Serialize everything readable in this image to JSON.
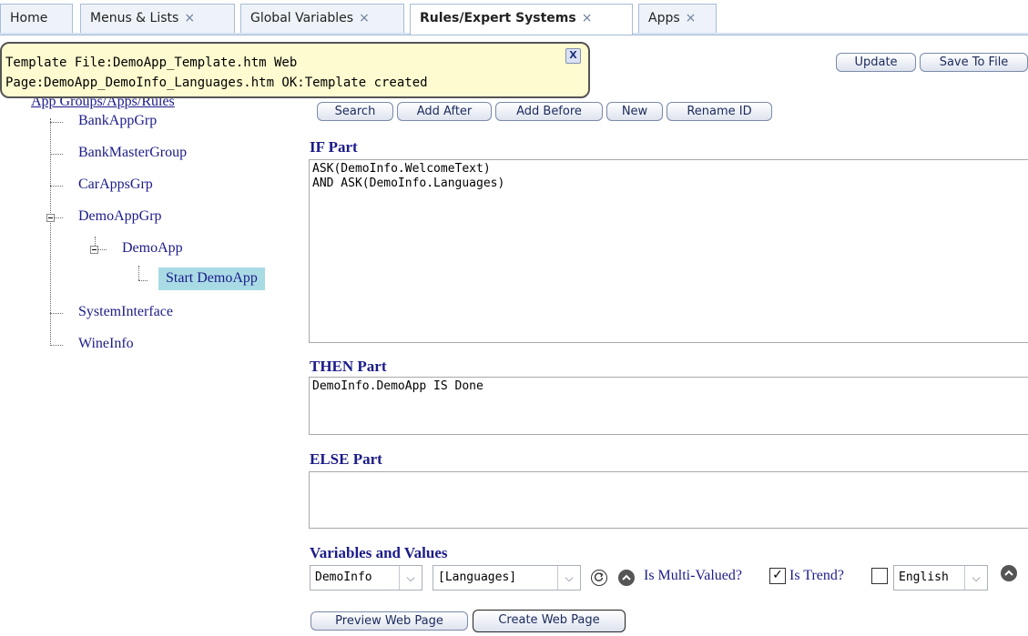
{
  "tabs": [
    {
      "label": "Home",
      "closable": false
    },
    {
      "label": "Menus & Lists",
      "closable": true
    },
    {
      "label": "Global Variables",
      "closable": true
    },
    {
      "label": "Rules/Expert Systems",
      "closable": true,
      "active": true
    },
    {
      "label": "Apps",
      "closable": true
    }
  ],
  "close_glyph": "×",
  "tooltip": {
    "line1": "Template File:DemoApp_Template.htm Web",
    "line2": "Page:DemoApp_DemoInfo_Languages.htm OK:Template created",
    "close_label": "X"
  },
  "tree": {
    "root_label": "App Groups/Apps/Rules",
    "items": {
      "bank_app_grp": "BankAppGrp",
      "bank_master_group": "BankMasterGroup",
      "car_apps_grp": "CarAppsGrp",
      "demo_app_grp": "DemoAppGrp",
      "demo_app": "DemoApp",
      "start_demo_app": "Start DemoApp",
      "system_interface": "SystemInterface",
      "wine_info": "WineInfo"
    }
  },
  "toolbar": {
    "update": "Update",
    "save_to_file": "Save To File",
    "search": "Search",
    "add_after": "Add After",
    "add_before": "Add Before",
    "new": "New",
    "rename_id": "Rename ID"
  },
  "rule": {
    "if_label": "IF Part",
    "if_text": "ASK(DemoInfo.WelcomeText)\nAND ASK(DemoInfo.Languages)",
    "then_label": "THEN Part",
    "then_text": "DemoInfo.DemoApp IS Done",
    "else_label": "ELSE Part",
    "else_text": ""
  },
  "variables": {
    "label": "Variables and Values",
    "object_select": "DemoInfo",
    "variable_select": "[Languages]",
    "is_multi_valued_label": "Is Multi-Valued?",
    "is_multi_valued": true,
    "is_trend_label": "Is Trend?",
    "is_trend": false,
    "language_select": "English"
  },
  "bottom": {
    "preview": "Preview Web Page",
    "create": "Create Web Page"
  },
  "colors": {
    "link_text": "#1b1b8a",
    "selected_node_bg": "#a9dbe4",
    "tooltip_bg": "#fffbd0"
  },
  "icons": {
    "checkmark": "✓",
    "dropdown_arrow": "⌵",
    "tree_expander": "minus-box"
  }
}
